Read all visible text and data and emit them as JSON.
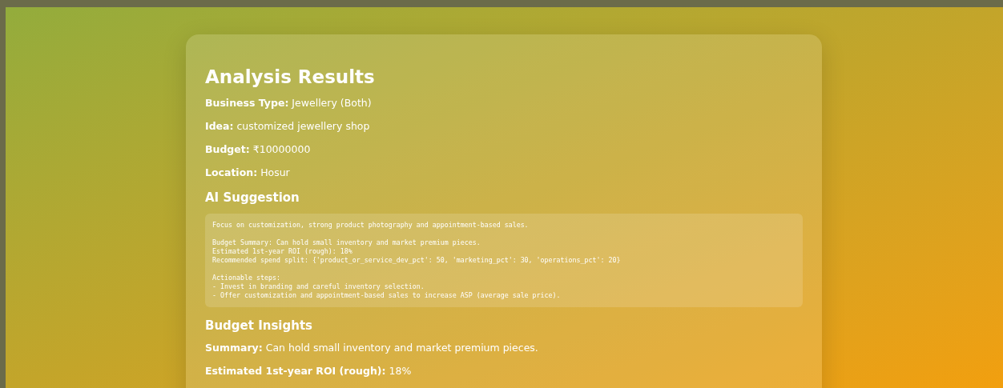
{
  "title": "Analysis Results",
  "details": [
    "**Business Type:** Jewellery (Both)",
    "**Idea:** customized jewellery shop",
    "**Budget:** ₹10000000",
    "**Location:** Hosur"
  ],
  "ai_suggestion": {
    "heading": "AI Suggestion",
    "paragraphs": [
      [
        "Focus on customization, strong product photography and appointment-based sales."
      ],
      [
        "Budget Summary: Can hold small inventory and market premium pieces.",
        "Estimated 1st-year ROI (rough): 18%",
        "Recommended spend split: {'product_or_service_dev_pct': 50, 'marketing_pct': 30, 'operations_pct': 20}"
      ],
      [
        "Actionable steps:",
        "- Invest in branding and careful inventory selection.",
        "- Offer customization and appointment-based sales to increase ASP (average sale price)."
      ]
    ]
  },
  "budget_insights": {
    "heading": "Budget Insights",
    "items": [
      "**Summary:** Can hold small inventory and market premium pieces.",
      "**Estimated 1st-year ROI (rough):** 18%"
    ]
  }
}
